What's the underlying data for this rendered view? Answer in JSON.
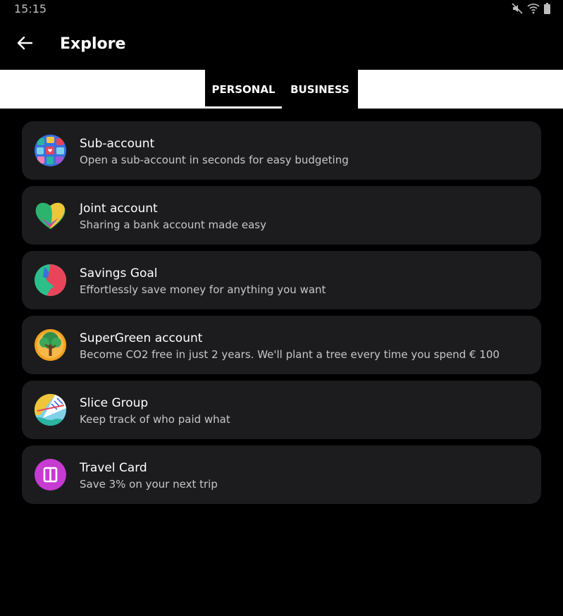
{
  "status": {
    "time": "15:15"
  },
  "header": {
    "title": "Explore",
    "back_icon": "arrow-left-icon"
  },
  "tabs": [
    {
      "label": "PERSONAL",
      "active": true
    },
    {
      "label": "BUSINESS",
      "active": false
    }
  ],
  "items": [
    {
      "title": "Sub-account",
      "subtitle": "Open a sub-account in seconds for easy budgeting",
      "icon": "sub-account-icon"
    },
    {
      "title": "Joint account",
      "subtitle": "Sharing a bank account made easy",
      "icon": "joint-account-icon"
    },
    {
      "title": "Savings Goal",
      "subtitle": "Effortlessly save money for anything you want",
      "icon": "savings-goal-icon"
    },
    {
      "title": "SuperGreen account",
      "subtitle": "Become CO2 free in just 2 years. We'll plant a tree every time you spend € 100",
      "icon": "tree-icon"
    },
    {
      "title": "Slice Group",
      "subtitle": "Keep track of who paid what",
      "icon": "slice-group-icon"
    },
    {
      "title": "Travel Card",
      "subtitle": "Save 3% on your next trip",
      "icon": "travel-card-icon"
    }
  ],
  "colors": {
    "background": "#000000",
    "card": "#1c1c1e",
    "accent_travel": "#c63bd1"
  }
}
